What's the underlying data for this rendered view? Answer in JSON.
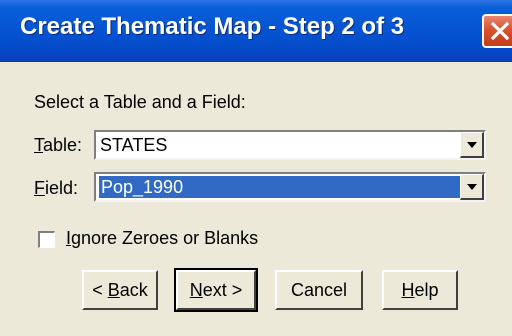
{
  "window": {
    "title": "Create Thematic Map - Step 2 of 3"
  },
  "prompt": "Select a Table and a Field:",
  "table_field": {
    "label_mnemonic": "T",
    "label_rest": "able:",
    "value": "STATES"
  },
  "field_field": {
    "label_mnemonic": "F",
    "label_rest": "ield:",
    "value": "Pop_1990"
  },
  "ignore_zeroes": {
    "label_mnemonic": "I",
    "label_rest": "gnore Zeroes or Blanks",
    "checked": false
  },
  "buttons": {
    "back": {
      "prefix": "< ",
      "mnemonic": "B",
      "rest": "ack"
    },
    "next": {
      "mnemonic": "N",
      "rest": "ext >"
    },
    "cancel": {
      "label": "Cancel"
    },
    "help": {
      "mnemonic": "H",
      "rest": "elp"
    }
  },
  "icons": {
    "close": "close-icon",
    "dropdown": "chevron-down-icon"
  },
  "colors": {
    "titlebar": "#0553d2",
    "selection": "#316ac5",
    "dialog_bg": "#ece9d8",
    "close_button": "#d9532f"
  }
}
